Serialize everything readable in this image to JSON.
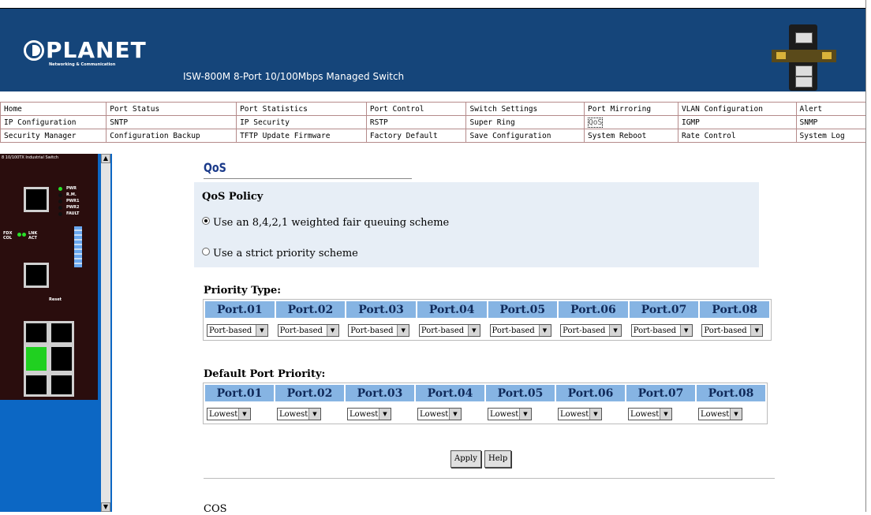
{
  "header": {
    "brand": "PLANET",
    "brand_tagline": "Networking & Communication",
    "product_title": "ISW-800M 8-Port 10/100Mbps Managed Switch"
  },
  "menu": {
    "rows": [
      [
        "Home",
        "Port Status",
        "Port Statistics",
        "Port Control",
        "Switch Settings",
        "Port Mirroring",
        "VLAN Configuration",
        "Alert"
      ],
      [
        "IP Configuration",
        "SNTP",
        "IP Security",
        "RSTP",
        "Super Ring",
        "QoS",
        "IGMP",
        "SNMP"
      ],
      [
        "Security Manager",
        "Configuration Backup",
        "TFTP Update Firmware",
        "Factory Default",
        "Save Configuration",
        "System Reboot",
        "Rate Control",
        "System Log"
      ]
    ],
    "active": "QoS"
  },
  "device_panel": {
    "title": "8 10/100TX Industrial Switch",
    "led_labels": [
      "PWR",
      "R.M.",
      "PWR1",
      "PWR2",
      "FAULT"
    ],
    "reset_label": "Reset",
    "fdx_col": "FDX COL",
    "lnk_act": "LNK ACT"
  },
  "qos": {
    "title": "QoS",
    "policy_heading": "QoS Policy",
    "option_weighted": "Use an 8,4,2,1 weighted fair queuing scheme",
    "option_strict": "Use a strict priority scheme",
    "selected_option": "weighted"
  },
  "priority_type": {
    "heading": "Priority Type:",
    "ports": [
      "Port.01",
      "Port.02",
      "Port.03",
      "Port.04",
      "Port.05",
      "Port.06",
      "Port.07",
      "Port.08"
    ],
    "values": [
      "Port-based",
      "Port-based",
      "Port-based",
      "Port-based",
      "Port-based",
      "Port-based",
      "Port-based",
      "Port-based"
    ]
  },
  "default_priority": {
    "heading": "Default Port Priority:",
    "ports": [
      "Port.01",
      "Port.02",
      "Port.03",
      "Port.04",
      "Port.05",
      "Port.06",
      "Port.07",
      "Port.08"
    ],
    "values": [
      "Lowest",
      "Lowest",
      "Lowest",
      "Lowest",
      "Lowest",
      "Lowest",
      "Lowest",
      "Lowest"
    ]
  },
  "buttons": {
    "apply": "Apply",
    "help": "Help"
  },
  "cos_heading": "COS",
  "colors": {
    "header_bg": "#15457a",
    "sidebar_bg": "#0c67c4",
    "panel_bg": "#2a0d0d",
    "port_header_bg": "#86b4e3",
    "policy_bg": "#e7eef6"
  }
}
